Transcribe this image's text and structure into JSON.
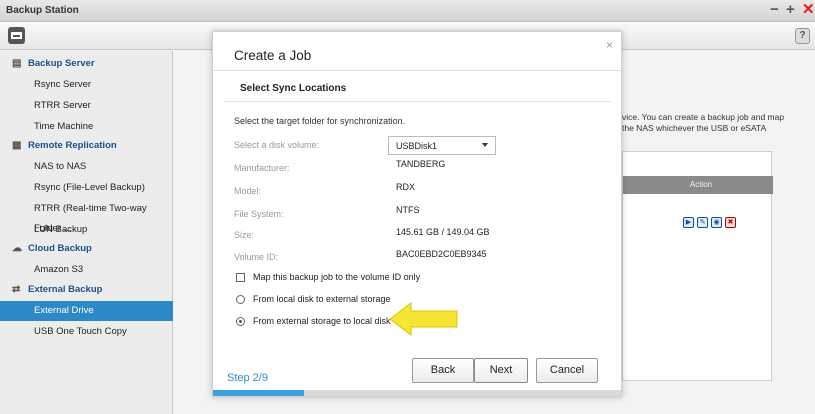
{
  "window": {
    "title": "Backup Station"
  },
  "toolbar": {
    "help_label": "?"
  },
  "sidebar": {
    "items": [
      {
        "label": "Backup Server",
        "type": "header",
        "icon": "server-icon"
      },
      {
        "label": "Rsync Server",
        "type": "sub"
      },
      {
        "label": "RTRR Server",
        "type": "sub"
      },
      {
        "label": "Time Machine",
        "type": "sub"
      },
      {
        "label": "Remote Replication",
        "type": "header",
        "icon": "replication-icon"
      },
      {
        "label": "NAS to NAS",
        "type": "sub"
      },
      {
        "label": "Rsync (File-Level Backup)",
        "type": "sub"
      },
      {
        "label": "RTRR (Real-time Two-way Folder ...",
        "type": "sub"
      },
      {
        "label": "LUN Backup",
        "type": "sub"
      },
      {
        "label": "Cloud Backup",
        "type": "header",
        "icon": "cloud-icon"
      },
      {
        "label": "Amazon S3",
        "type": "sub"
      },
      {
        "label": "External Backup",
        "type": "header",
        "icon": "sync-icon"
      },
      {
        "label": "External Drive",
        "type": "sub",
        "active": true
      },
      {
        "label": "USB One Touch Copy",
        "type": "sub"
      }
    ]
  },
  "background": {
    "desc_line1": "vice. You can create a backup job and map",
    "desc_line2": "the NAS whichever the USB or eSATA",
    "action_header": "Action"
  },
  "modal": {
    "title": "Create a Job",
    "close_label": "×",
    "step_title": "Select Sync Locations",
    "description": "Select the target folder for synchronization.",
    "disk_volume_label": "Select a disk volume:",
    "disk_volume_value": "USBDisk1",
    "manufacturer_label": "Manufacturer:",
    "manufacturer_value": "TANDBERG",
    "model_label": "Model:",
    "model_value": "RDX",
    "filesystem_label": "File System:",
    "filesystem_value": "NTFS",
    "size_label": "Size:",
    "size_value": "145.61 GB / 149.04 GB",
    "volume_id_label": "Volume ID:",
    "volume_id_value": "BAC0EBD2C0EB9345",
    "map_checkbox_label": "Map this backup job to the volume ID only",
    "map_checkbox_checked": false,
    "radio_local_to_external": "From local disk to external storage",
    "radio_external_to_local": "From external storage to local disk",
    "selected_direction": "external_to_local",
    "step_indicator": "Step 2/9",
    "progress_fraction": 0.222,
    "back_label": "Back",
    "next_label": "Next",
    "cancel_label": "Cancel"
  },
  "colors": {
    "accent": "#2d88c8",
    "sidebar_header": "#1d4f8c",
    "step_text": "#2d8fd5",
    "arrow_fill": "#f7e534",
    "close_red": "#e02020"
  }
}
